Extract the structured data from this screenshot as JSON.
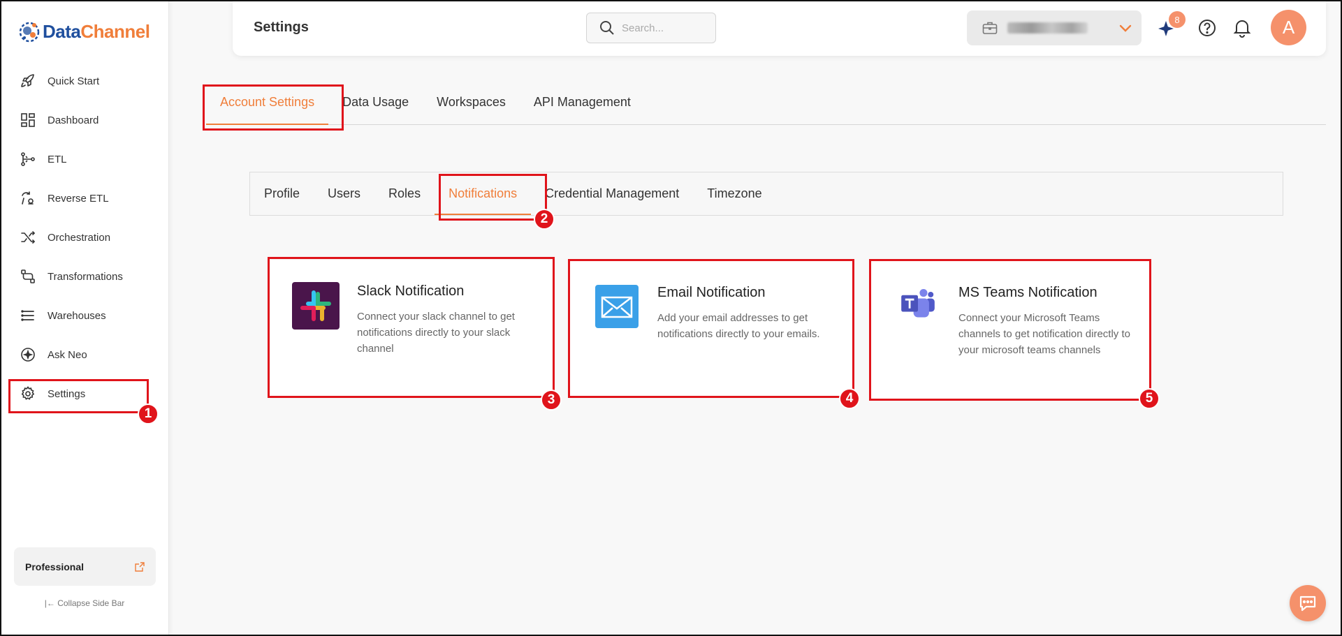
{
  "brand": {
    "logo_part1": "Data",
    "logo_part2": "Channel"
  },
  "sidebar": {
    "items": [
      {
        "label": "Quick Start",
        "icon": "rocket-icon"
      },
      {
        "label": "Dashboard",
        "icon": "dashboard-icon"
      },
      {
        "label": "ETL",
        "icon": "etl-icon"
      },
      {
        "label": "Reverse ETL",
        "icon": "reverse-etl-icon"
      },
      {
        "label": "Orchestration",
        "icon": "orchestration-icon"
      },
      {
        "label": "Transformations",
        "icon": "transformations-icon"
      },
      {
        "label": "Warehouses",
        "icon": "warehouses-icon"
      },
      {
        "label": "Ask Neo",
        "icon": "ask-neo-icon"
      },
      {
        "label": "Settings",
        "icon": "gear-icon"
      }
    ],
    "plan_label": "Professional",
    "collapse_label": "Collapse Side Bar"
  },
  "header": {
    "title": "Settings",
    "search_placeholder": "Search...",
    "notification_count": "8",
    "avatar_initial": "A"
  },
  "main_tabs": [
    "Account Settings",
    "Data Usage",
    "Workspaces",
    "API Management"
  ],
  "sub_tabs": [
    "Profile",
    "Users",
    "Roles",
    "Notifications",
    "Credential Management",
    "Timezone"
  ],
  "cards": [
    {
      "title": "Slack Notification",
      "description": "Connect your slack channel to get notifications directly to your slack channel"
    },
    {
      "title": "Email Notification",
      "description": "Add your email addresses to get notifications directly to your emails."
    },
    {
      "title": "MS Teams Notification",
      "description": "Connect your Microsoft Teams channels to get notification directly to your microsoft teams channels"
    }
  ],
  "markers": [
    "1",
    "2",
    "3",
    "4",
    "5"
  ],
  "colors": {
    "accent": "#f07e3a",
    "brand_blue": "#1f4f9e",
    "highlight": "#e0141b"
  }
}
